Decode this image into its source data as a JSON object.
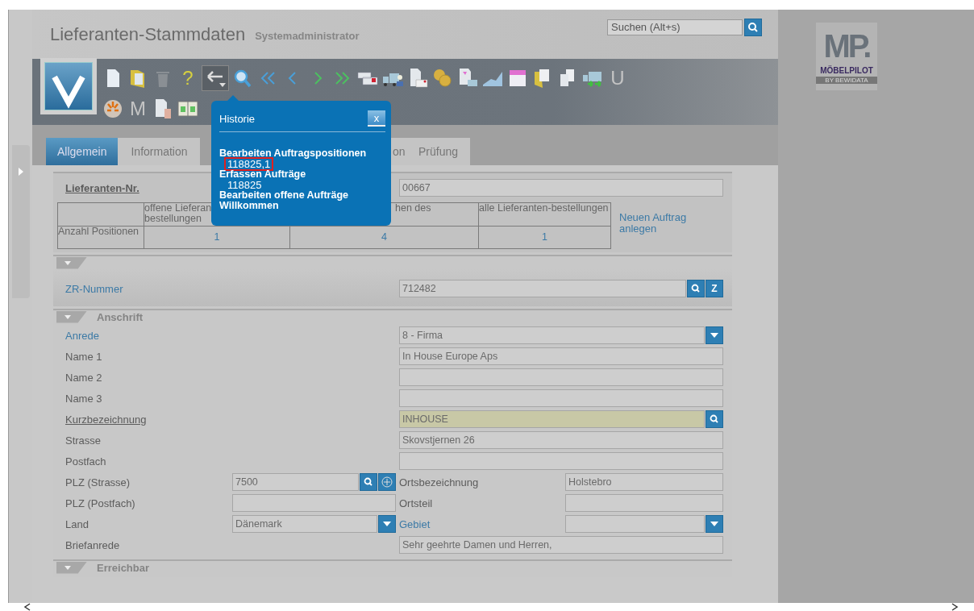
{
  "header": {
    "title": "Lieferanten-Stammdaten",
    "user": "Systemadministrator",
    "search": {
      "placeholder": "Suchen (Alt+s)"
    }
  },
  "logo": {
    "mark": "MP.",
    "name": "MÖBELPILOT",
    "tagline": "BY BEWIDATA"
  },
  "toolbar": {
    "rows": [
      [
        {
          "kind": "doc"
        },
        {
          "kind": "folder"
        },
        {
          "kind": "trash"
        },
        {
          "kind": "help",
          "text": "?"
        },
        {
          "kind": "back",
          "pressed": true
        },
        {
          "kind": "search"
        },
        {
          "kind": "first"
        },
        {
          "kind": "prev"
        },
        {
          "kind": "next"
        },
        {
          "kind": "last"
        },
        {
          "kind": "cards"
        },
        {
          "kind": "truck"
        },
        {
          "kind": "docmail"
        },
        {
          "kind": "coins"
        },
        {
          "kind": "doctruck"
        },
        {
          "kind": "chart"
        },
        {
          "kind": "calendar"
        },
        {
          "kind": "folderdocs"
        },
        {
          "kind": "copy"
        },
        {
          "kind": "truckarrows"
        },
        {
          "kind": "letter",
          "text": "U"
        }
      ],
      [
        {
          "kind": "burst"
        },
        {
          "kind": "letter",
          "text": "M"
        },
        {
          "kind": "dochand"
        },
        {
          "kind": "book"
        }
      ]
    ]
  },
  "tabs": [
    {
      "label": "Allgemein",
      "selected": true
    },
    {
      "label": "Information",
      "selected": false
    },
    {
      "label": "on",
      "selected": false
    },
    {
      "label": "Prüfung",
      "selected": false
    }
  ],
  "supplier_number": {
    "label": "Lieferanten-Nr.",
    "value": "00667"
  },
  "summary_table": {
    "columns": [
      "",
      "offene Lieferan\nbestellungen",
      "hen des",
      "alle Lieferanten-bestellungen"
    ],
    "row_label": "Anzahl Positionen",
    "values": [
      "1",
      "4",
      "1"
    ],
    "link": "Neuen Auftrag anlegen"
  },
  "sections": [
    {
      "expanded": true,
      "rows": [
        {
          "cells": [
            {
              "label": "ZR-Nummer",
              "link": true,
              "underlined": false,
              "control": {
                "kind": "input",
                "value": "712482",
                "highlighted": false,
                "buttons": [
                  {
                    "kind": "search"
                  },
                  {
                    "kind": "text",
                    "text": "Z"
                  }
                ]
              }
            }
          ]
        }
      ]
    },
    {
      "title": "Anschrift",
      "expanded": true,
      "rows": [
        {
          "cells": [
            {
              "label": "Anrede",
              "link": true,
              "underlined": false,
              "control": {
                "kind": "select",
                "value": "8 - Firma"
              }
            }
          ]
        },
        {
          "cells": [
            {
              "label": "Name 1",
              "link": false,
              "underlined": false,
              "control": {
                "kind": "input",
                "value": "In House Europe Aps",
                "highlighted": false
              }
            }
          ]
        },
        {
          "cells": [
            {
              "label": "Name 2",
              "link": false,
              "underlined": false,
              "control": {
                "kind": "input",
                "highlighted": false
              }
            }
          ]
        },
        {
          "cells": [
            {
              "label": "Name 3",
              "link": false,
              "underlined": false,
              "control": {
                "kind": "input",
                "highlighted": false
              }
            }
          ]
        },
        {
          "cells": [
            {
              "label": "Kurzbezeichnung",
              "link": false,
              "underlined": true,
              "control": {
                "kind": "input",
                "value": "INHOUSE",
                "highlighted": true,
                "buttons": [
                  {
                    "kind": "search"
                  }
                ]
              }
            }
          ]
        },
        {
          "cells": [
            {
              "label": "Strasse",
              "link": false,
              "underlined": false,
              "control": {
                "kind": "input",
                "value": "Skovstjernen 26",
                "highlighted": false
              }
            }
          ]
        },
        {
          "cells": [
            {
              "label": "Postfach",
              "link": false,
              "underlined": false,
              "control": {
                "kind": "input",
                "highlighted": false
              }
            }
          ]
        },
        {
          "cells": [
            {
              "label": "PLZ (Strasse)",
              "link": false,
              "underlined": false,
              "control": {
                "kind": "input",
                "value": "7500",
                "highlighted": false,
                "buttons": [
                  {
                    "kind": "search"
                  },
                  {
                    "kind": "plus"
                  }
                ]
              }
            },
            {
              "label": "Ortsbezeichnung",
              "link": false,
              "underlined": false,
              "control": {
                "kind": "input",
                "value": "Holstebro",
                "highlighted": false
              }
            }
          ]
        },
        {
          "cells": [
            {
              "label": "PLZ (Postfach)",
              "link": false,
              "underlined": false,
              "control": {
                "kind": "input",
                "highlighted": false
              }
            },
            {
              "label": "Ortsteil",
              "link": false,
              "underlined": false,
              "control": {
                "kind": "input",
                "highlighted": false
              }
            }
          ]
        },
        {
          "cells": [
            {
              "label": "Land",
              "link": false,
              "underlined": false,
              "control": {
                "kind": "select",
                "value": "Dänemark"
              }
            },
            {
              "label": "Gebiet",
              "link": true,
              "underlined": false,
              "control": {
                "kind": "select"
              }
            }
          ]
        },
        {
          "cells": [
            {
              "label": "Briefanrede",
              "link": false,
              "underlined": false,
              "control": {
                "kind": "input",
                "value": "Sehr geehrte Damen und Herren,",
                "highlighted": false
              }
            }
          ]
        }
      ]
    },
    {
      "title": "Erreichbar",
      "expanded": true
    }
  ],
  "history_popup": {
    "title": "Historie",
    "close": "x",
    "items": [
      {
        "title": "Bearbeiten Auftragspositionen",
        "children": [
          {
            "label": "118825,1",
            "highlighted": true
          }
        ]
      },
      {
        "title": "Erfassen Aufträge",
        "children": [
          {
            "label": "118825",
            "highlighted": false
          }
        ]
      },
      {
        "title": "Bearbeiten offene Aufträge"
      },
      {
        "title": "Willkommen"
      }
    ]
  }
}
